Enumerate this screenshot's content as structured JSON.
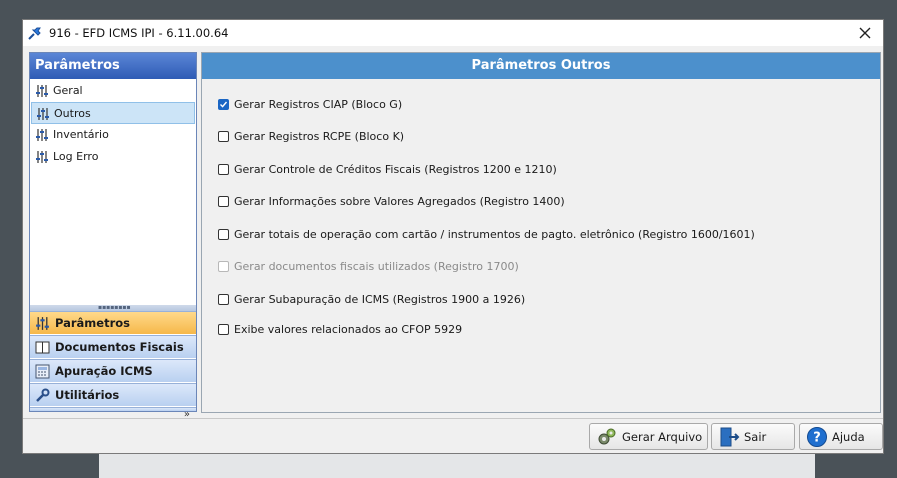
{
  "window": {
    "title": "916 - EFD ICMS IPI - 6.11.00.64"
  },
  "left_panel": {
    "header": "Parâmetros",
    "tree_items": [
      {
        "label": "Geral",
        "selected": false
      },
      {
        "label": "Outros",
        "selected": true
      },
      {
        "label": "Inventário",
        "selected": false
      },
      {
        "label": "Log Erro",
        "selected": false
      }
    ],
    "nav": [
      {
        "label": "Parâmetros",
        "icon": "sliders-icon",
        "active": true
      },
      {
        "label": "Documentos Fiscais",
        "icon": "book-icon",
        "active": false
      },
      {
        "label": "Apuração ICMS",
        "icon": "calculator-icon",
        "active": false
      },
      {
        "label": "Utilitários",
        "icon": "wrench-icon",
        "active": false
      }
    ],
    "more_glyph": "»"
  },
  "right_panel": {
    "header": "Parâmetros Outros",
    "options": [
      {
        "label": "Gerar Registros CIAP (Bloco G)",
        "checked": true,
        "enabled": true
      },
      {
        "label": "Gerar Registros RCPE (Bloco K)",
        "checked": false,
        "enabled": true
      },
      {
        "label": "Gerar Controle de Créditos Fiscais (Registros 1200 e 1210)",
        "checked": false,
        "enabled": true
      },
      {
        "label": "Gerar Informações sobre Valores Agregados (Registro 1400)",
        "checked": false,
        "enabled": true
      },
      {
        "label": "Gerar totais de operação com cartão / instrumentos de pagto. eletrônico (Registro 1600/1601)",
        "checked": false,
        "enabled": true
      },
      {
        "label": "Gerar documentos fiscais utilizados (Registro 1700)",
        "checked": false,
        "enabled": false
      },
      {
        "label": "Gerar Subapuração de ICMS (Registros 1900 a 1926)",
        "checked": false,
        "enabled": true
      },
      {
        "label": "Exibe valores relacionados ao CFOP 5929",
        "checked": false,
        "enabled": true
      }
    ]
  },
  "buttons": {
    "gerar_arquivo": "Gerar Arquivo",
    "sair": "Sair",
    "ajuda": "Ajuda"
  },
  "colors": {
    "accent": "#4c90cc",
    "nav_active": "#f6b84a",
    "check": "#1a66c4"
  }
}
